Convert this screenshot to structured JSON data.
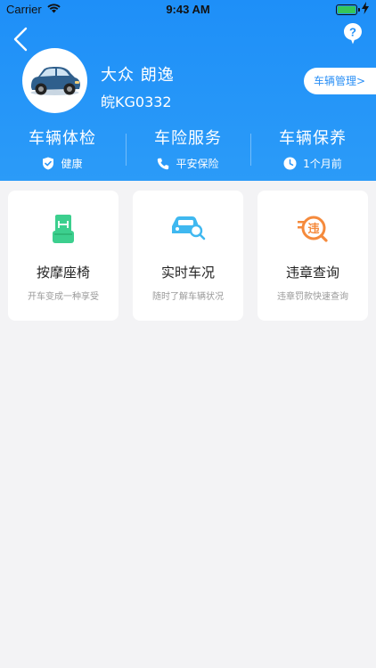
{
  "status_bar": {
    "carrier": "Carrier",
    "time": "9:43 AM"
  },
  "header": {
    "car_name": "大众  朗逸",
    "plate": "皖KG0332",
    "manage_button": "车辆管理>"
  },
  "stats": [
    {
      "title": "车辆体检",
      "sub": "健康",
      "icon": "shield-check-icon"
    },
    {
      "title": "车险服务",
      "sub": "平安保险",
      "icon": "phone-icon"
    },
    {
      "title": "车辆保养",
      "sub": "1个月前",
      "icon": "clock-icon"
    }
  ],
  "cards": [
    {
      "title": "按摩座椅",
      "desc": "开车变成一种享受",
      "icon": "massage-seat-icon",
      "color": "#3ccf8e"
    },
    {
      "title": "实时车况",
      "desc": "随时了解车辆状况",
      "icon": "car-search-icon",
      "color": "#3fb8f0"
    },
    {
      "title": "违章查询",
      "desc": "违章罚款快速查询",
      "icon": "violation-search-icon",
      "color": "#f58a3c"
    }
  ],
  "colors": {
    "header_blue": "#1e8ff8",
    "background": "#f3f3f5"
  }
}
